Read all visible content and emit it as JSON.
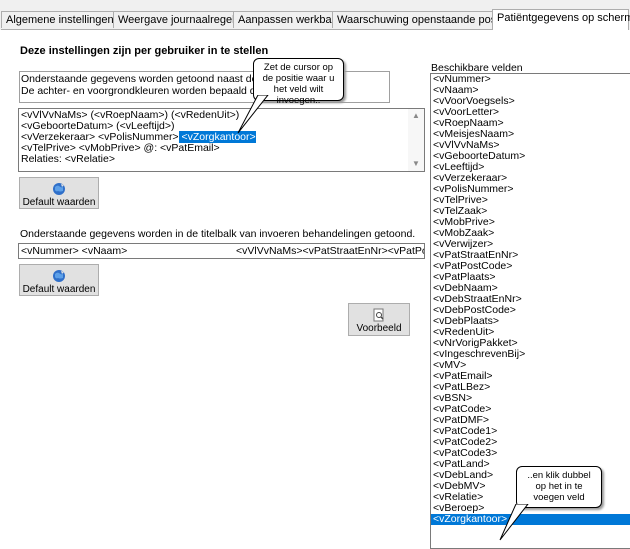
{
  "tabs": [
    {
      "label": "Algemene instellingen",
      "active": false
    },
    {
      "label": "Weergave journaalregels",
      "active": false
    },
    {
      "label": "Aanpassen werkbalk",
      "active": false
    },
    {
      "label": "Waarschuwing openstaande posten",
      "active": false
    },
    {
      "label": "Patiëntgegevens op scherm",
      "active": true
    }
  ],
  "heading": "Deze instellingen zijn per gebruiker in te stellen",
  "description": {
    "line1": "Onderstaande gegevens worden getoond naast de eve",
    "line2": "De achter- en voorgrondkleuren worden bepaald door d"
  },
  "editor": {
    "line1": "<vVlVvNaMs> (<vRoepNaam>) (<vRedenUit>)",
    "line2": "<vGeboorteDatum> (<vLeeftijd>)",
    "line3_before": "<vVerzekeraar> <vPolisNummer>",
    "line3_selected": " <vZorgkantoor>",
    "line4": "<vTelPrive> <vMobPrive>  @: <vPatEmail>",
    "line5": "Relaties: <vRelatie>"
  },
  "default_button_1": "Default waarden",
  "title_description": "Onderstaande gegevens worden in de titelbalk van invoeren behandelingen getoond.",
  "title_field": {
    "left": "<vNummer>  <vNaam>",
    "right": "<vVlVvNaMs><vPatStraatEnNr><vPatPostC"
  },
  "default_button_2": "Default waarden",
  "preview_button": "Voorbeeld",
  "available_label": "Beschikbare velden",
  "fields": [
    "<vNummer>",
    "<vNaam>",
    "<vVoorVoegsels>",
    "<vVoorLetter>",
    "<vRoepNaam>",
    "<vMeisjesNaam>",
    "<vVlVvNaMs>",
    "<vGeboorteDatum>",
    "<vLeeftijd>",
    "<vVerzekeraar>",
    "<vPolisNummer>",
    "<vTelPrive>",
    "<vTelZaak>",
    "<vMobPrive>",
    "<vMobZaak>",
    "<vVerwijzer>",
    "<vPatStraatEnNr>",
    "<vPatPostCode>",
    "<vPatPlaats>",
    "<vDebNaam>",
    "<vDebStraatEnNr>",
    "<vDebPostCode>",
    "<vDebPlaats>",
    "<vRedenUit>",
    "<vNrVorigPakket>",
    "<vIngeschrevenBij>",
    "<vMV>",
    "<vPatEmail>",
    "<vPatLBez>",
    "<vBSN>",
    "<vPatCode>",
    "<vPatDMF>",
    "<vPatCode1>",
    "<vPatCode2>",
    "<vPatCode3>",
    "<vPatLand>",
    "<vDebLand>",
    "<vDebMV>",
    "<vRelatie>",
    "<vBeroep>",
    "<vZorgkantoor>"
  ],
  "selected_field": "<vZorgkantoor>",
  "callout_1": "Zet de cursor op de positie waar u het veld wilt invoegen..",
  "callout_2": "..en klik dubbel op het in te voegen veld",
  "colors": {
    "selection": "#0078d7",
    "button_face": "#e1e1e1",
    "tab_bg": "#f0f0f0"
  },
  "icons": {
    "default_button": "globe-refresh-icon",
    "preview_button": "magnifier-page-icon"
  }
}
